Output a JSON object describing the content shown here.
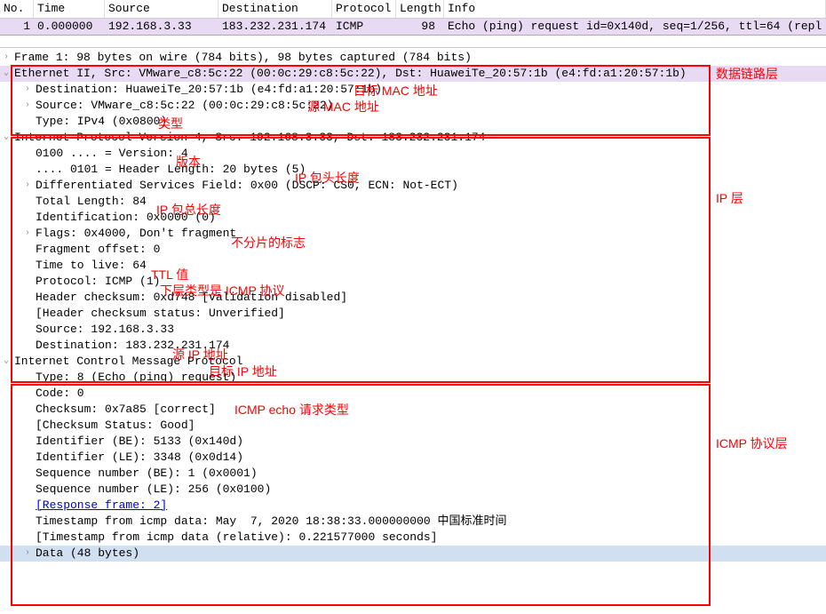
{
  "columns": {
    "no": "No.",
    "time": "Time",
    "source": "Source",
    "destination": "Destination",
    "protocol": "Protocol",
    "length": "Length",
    "info": "Info"
  },
  "row": {
    "no": "1",
    "time": "0.000000",
    "source": "192.168.3.33",
    "destination": "183.232.231.174",
    "protocol": "ICMP",
    "length": "98",
    "info": "Echo (ping) request  id=0x140d, seq=1/256, ttl=64 (repl"
  },
  "frame": "Frame 1: 98 bytes on wire (784 bits), 98 bytes captured (784 bits)",
  "eth": {
    "summary": "Ethernet II, Src: VMware_c8:5c:22 (00:0c:29:c8:5c:22), Dst: HuaweiTe_20:57:1b (e4:fd:a1:20:57:1b)",
    "dst": "Destination: HuaweiTe_20:57:1b (e4:fd:a1:20:57:1b)",
    "src": "Source: VMware_c8:5c:22 (00:0c:29:c8:5c:22)",
    "type": "Type: IPv4 (0x0800)"
  },
  "ip": {
    "summary": "Internet Protocol Version 4, Src: 192.168.3.33, Dst: 183.232.231.174",
    "version": "0100 .... = Version: 4",
    "hlen": ".... 0101 = Header Length: 20 bytes (5)",
    "dsf": "Differentiated Services Field: 0x00 (DSCP: CS0, ECN: Not-ECT)",
    "tlen": "Total Length: 84",
    "ident": "Identification: 0x0000 (0)",
    "flags": "Flags: 0x4000, Don't fragment",
    "frag": "Fragment offset: 0",
    "ttl": "Time to live: 64",
    "proto": "Protocol: ICMP (1)",
    "hcksum": "Header checksum: 0xd748 [validation disabled]",
    "hcstat": "[Header checksum status: Unverified]",
    "src": "Source: 192.168.3.33",
    "dst": "Destination: 183.232.231.174"
  },
  "icmp": {
    "summary": "Internet Control Message Protocol",
    "type": "Type: 8 (Echo (ping) request)",
    "code": "Code: 0",
    "cksum": "Checksum: 0x7a85 [correct]",
    "cstat": "[Checksum Status: Good]",
    "id_be": "Identifier (BE): 5133 (0x140d)",
    "id_le": "Identifier (LE): 3348 (0x0d14)",
    "seq_be": "Sequence number (BE): 1 (0x0001)",
    "seq_le": "Sequence number (LE): 256 (0x0100)",
    "resp": "[Response frame: 2]",
    "ts": "Timestamp from icmp data: May  7, 2020 18:38:33.000000000 中国标准时间",
    "tsr": "[Timestamp from icmp data (relative): 0.221577000 seconds]",
    "data": "Data (48 bytes)"
  },
  "anno": {
    "dll": "数据链路层",
    "dstmac": "目标 MAC 地址",
    "srcmac": "源 MAC 地址",
    "type": "类型",
    "ipl": "IP 层",
    "ver": "版本",
    "hlen": "IP 包头长度",
    "tlen": "IP 包总长度",
    "flags": "不分片的标志",
    "ttl": "TTL 值",
    "proto": "下层类型是 ICMP 协议",
    "srcip": "源 IP 地址",
    "dstip": "目标 IP 地址",
    "icmptype": "ICMP echo 请求类型",
    "icmpl": "ICMP 协议层"
  }
}
